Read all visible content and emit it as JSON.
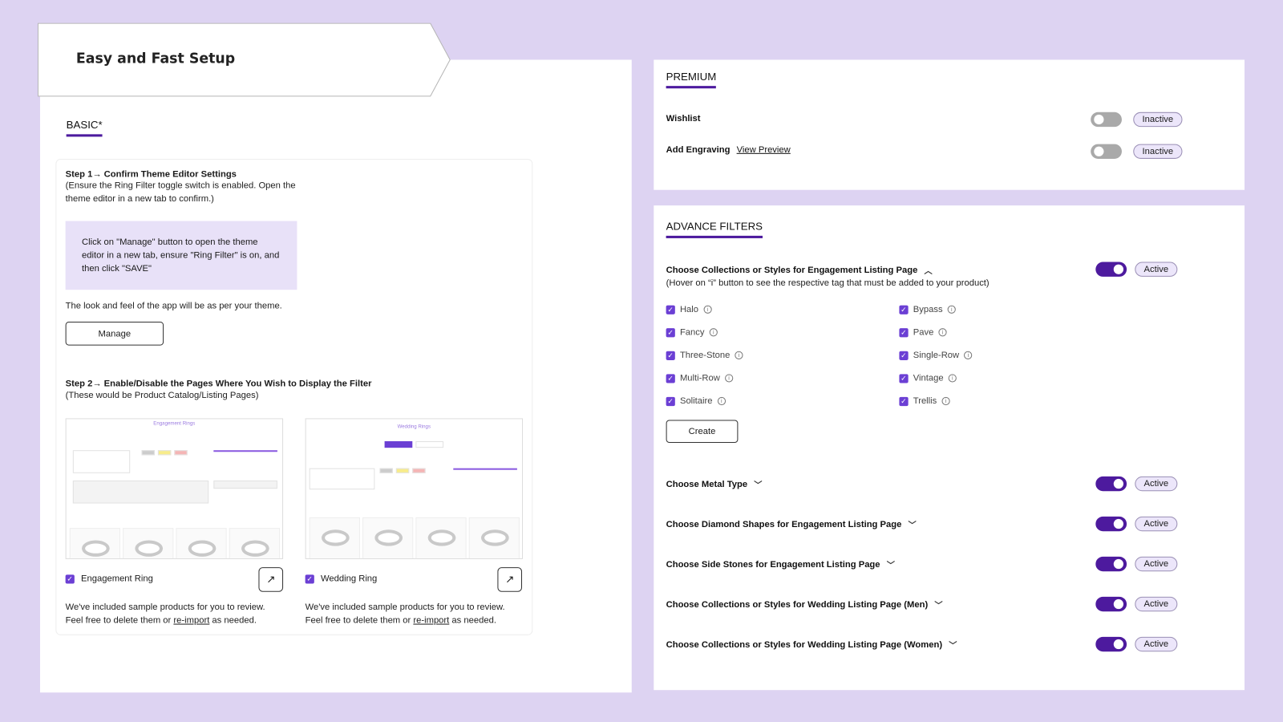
{
  "colors": {
    "background": "#ddd3f2",
    "accent": "#4d1a9e",
    "checkbox": "#6b3fd4",
    "info_box": "#e8e1f8",
    "badge_bg": "#ece6fa",
    "toggle_off": "#a9a9a9"
  },
  "header": {
    "title": "Easy and Fast Setup"
  },
  "basic": {
    "tab": "BASIC*",
    "step1": {
      "title": "Step 1→  Confirm Theme Editor Settings",
      "desc": "(Ensure the Ring Filter toggle switch is enabled. Open the theme editor in a new tab to confirm.)",
      "info": "Click on \"Manage\" button to open the theme editor in a new tab, ensure \"Ring Filter\" is on, and then click \"SAVE\"",
      "note": "The look and feel of the app will be as per your theme.",
      "manage_label": "Manage"
    },
    "step2": {
      "title": "Step 2→ Enable/Disable the Pages Where You Wish to Display the Filter",
      "desc": "(These would be Product Catalog/Listing Pages)"
    },
    "pages": [
      {
        "thumb_title": "Engagement Rings",
        "label": "Engagement Ring",
        "checked": true,
        "text1": "We've included sample products for you to review.",
        "text2_pre": "Feel free to delete them or ",
        "link": "re-import",
        "text2_post": " as needed.",
        "icon": "external-link-icon"
      },
      {
        "thumb_title": "Wedding Rings",
        "label": "Wedding Ring",
        "checked": true,
        "text1": "We've included sample products for you to review.",
        "text2_pre": "Feel free to delete them or ",
        "link": "re-import",
        "text2_post": " as needed.",
        "icon": "external-link-icon"
      }
    ]
  },
  "premium": {
    "tab": "PREMIUM",
    "items": [
      {
        "label": "Wishlist",
        "link": "",
        "enabled": false,
        "status": "Inactive"
      },
      {
        "label": "Add Engraving",
        "link": "View Preview",
        "enabled": false,
        "status": "Inactive"
      }
    ]
  },
  "advance": {
    "tab": "ADVANCE FILTERS",
    "collections": {
      "label": "Choose Collections or Styles for Engagement Listing Page",
      "hint": "(Hover on “i” button to see the respective tag that must be added to your product)",
      "enabled": true,
      "status": "Active",
      "expanded": true,
      "left": [
        "Halo",
        "Fancy",
        "Three-Stone",
        "Multi-Row",
        "Solitaire"
      ],
      "right": [
        "Bypass",
        "Pave",
        "Single-Row",
        "Vintage",
        "Trellis"
      ],
      "create_label": "Create"
    },
    "rows": [
      {
        "label": "Choose Metal Type",
        "enabled": true,
        "status": "Active"
      },
      {
        "label": "Choose Diamond Shapes for Engagement Listing Page",
        "enabled": true,
        "status": "Active"
      },
      {
        "label": "Choose Side Stones for Engagement Listing Page",
        "enabled": true,
        "status": "Active"
      },
      {
        "label": "Choose Collections or Styles for Wedding Listing Page (Men)",
        "enabled": true,
        "status": "Active"
      },
      {
        "label": "Choose Collections or Styles for Wedding Listing Page (Women)",
        "enabled": true,
        "status": "Active"
      }
    ]
  }
}
